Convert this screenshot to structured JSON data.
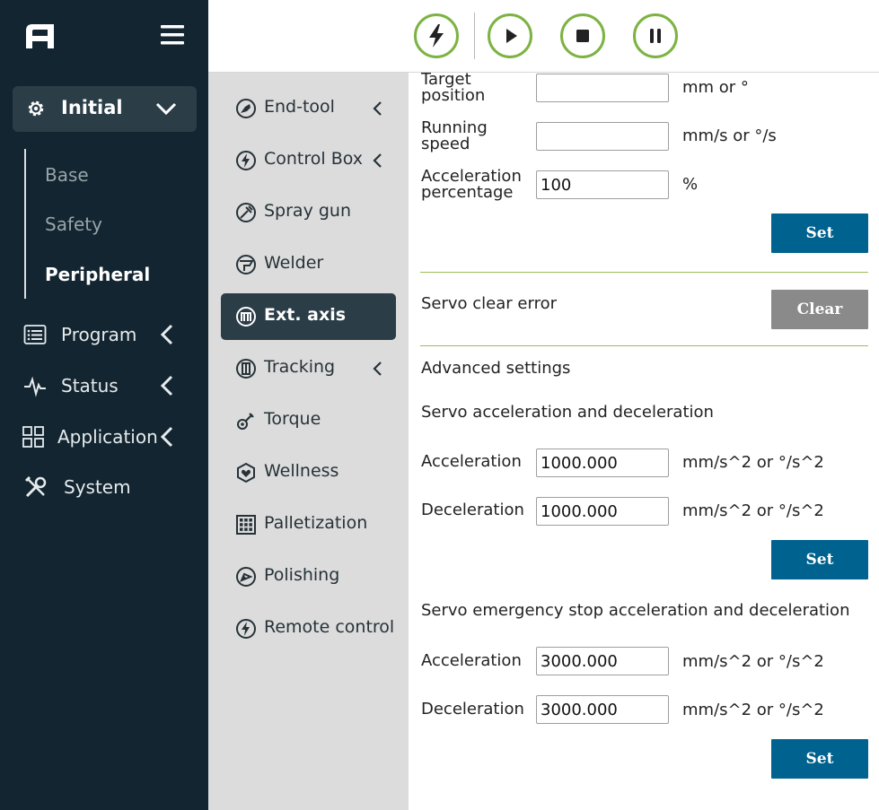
{
  "nav": {
    "initial_label": "Initial",
    "sub_items": [
      "Base",
      "Safety",
      "Peripheral"
    ],
    "main_items": [
      {
        "label": "Program",
        "icon": "list-icon"
      },
      {
        "label": "Status",
        "icon": "pulse-icon"
      },
      {
        "label": "Application",
        "icon": "grid-icon"
      },
      {
        "label": "System",
        "icon": "tools-icon"
      }
    ]
  },
  "toolbar": {
    "buttons": [
      "lightning-icon",
      "play-icon",
      "stop-icon",
      "pause-icon"
    ],
    "accent": "#7cb342"
  },
  "submenu": {
    "items": [
      {
        "label": "End-tool",
        "icon": "end-tool-icon",
        "chevron": true
      },
      {
        "label": "Control Box",
        "icon": "control-box-icon",
        "chevron": true
      },
      {
        "label": "Spray gun",
        "icon": "spray-gun-icon",
        "chevron": false
      },
      {
        "label": "Welder",
        "icon": "welder-icon",
        "chevron": false
      },
      {
        "label": "Ext. axis",
        "icon": "ext-axis-icon",
        "chevron": false,
        "active": true
      },
      {
        "label": "Tracking",
        "icon": "tracking-icon",
        "chevron": true
      },
      {
        "label": "Torque",
        "icon": "torque-icon",
        "chevron": false
      },
      {
        "label": "Wellness",
        "icon": "wellness-icon",
        "chevron": false
      },
      {
        "label": "Palletization",
        "icon": "palletization-icon",
        "chevron": false
      },
      {
        "label": "Polishing",
        "icon": "polishing-icon",
        "chevron": false
      },
      {
        "label": "Remote control",
        "icon": "remote-control-icon",
        "chevron": false
      }
    ]
  },
  "content": {
    "target_position": {
      "label_line1": "Target",
      "label_line2": "position",
      "value": "",
      "unit": "mm or °"
    },
    "running_speed": {
      "label_line1": "Running",
      "label_line2": "speed",
      "value": "",
      "unit": "mm/s or °/s"
    },
    "acceleration_percentage": {
      "label_line1": "Acceleration",
      "label_line2": "percentage",
      "value": "100",
      "unit": "%"
    },
    "set_label": "Set",
    "servo_clear_error": {
      "label": "Servo clear error",
      "button": "Clear"
    },
    "advanced_settings": "Advanced settings",
    "servo_accel_decel": {
      "title": "Servo acceleration and deceleration",
      "acceleration": {
        "label": "Acceleration",
        "value": "1000.000",
        "unit": "mm/s^2 or °/s^2"
      },
      "deceleration": {
        "label": "Deceleration",
        "value": "1000.000",
        "unit": "mm/s^2 or °/s^2"
      }
    },
    "servo_estop": {
      "title": "Servo emergency stop acceleration and deceleration",
      "acceleration": {
        "label": "Acceleration",
        "value": "3000.000",
        "unit": "mm/s^2 or °/s^2"
      },
      "deceleration": {
        "label": "Deceleration",
        "value": "3000.000",
        "unit": "mm/s^2 or °/s^2"
      }
    }
  },
  "colors": {
    "sidebar": "#132530",
    "sidebar_active": "#2b3d47",
    "submenu_bg": "#dcdcdc",
    "button_blue": "#00628e",
    "button_gray": "#8a8a8a",
    "divider": "#9bbd5a"
  }
}
